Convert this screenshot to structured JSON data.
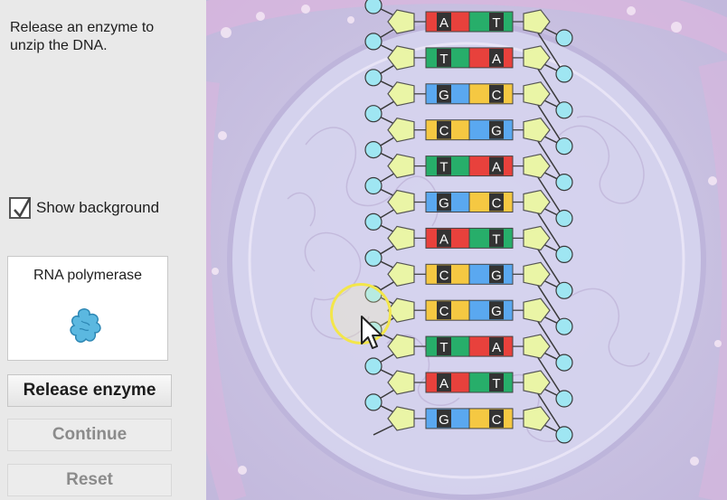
{
  "sidebar": {
    "instruction": "Release an enzyme to\nunzip the DNA.",
    "show_background": {
      "label": "Show background",
      "checked": true
    },
    "enzyme_panel": {
      "title": "RNA polymerase",
      "icon": "rna-polymerase-icon",
      "icon_color": "#5bb8e0"
    },
    "buttons": {
      "release": "Release enzyme",
      "continue": "Continue",
      "reset": "Reset"
    }
  },
  "dna": {
    "pairs": [
      {
        "left": "A",
        "right": "T"
      },
      {
        "left": "T",
        "right": "A"
      },
      {
        "left": "G",
        "right": "C"
      },
      {
        "left": "C",
        "right": "G"
      },
      {
        "left": "T",
        "right": "A"
      },
      {
        "left": "G",
        "right": "C"
      },
      {
        "left": "A",
        "right": "T"
      },
      {
        "left": "C",
        "right": "G"
      },
      {
        "left": "C",
        "right": "G"
      },
      {
        "left": "T",
        "right": "A"
      },
      {
        "left": "A",
        "right": "T"
      },
      {
        "left": "G",
        "right": "C"
      }
    ],
    "colors": {
      "A": "#e8413c",
      "T": "#27ae6a",
      "G": "#5aa8f0",
      "C": "#f5c842",
      "label_bg": "#333333",
      "label_fg": "#ffffff",
      "sugar": "#eaf5a6",
      "phosphate": "#9fe6f2"
    }
  }
}
